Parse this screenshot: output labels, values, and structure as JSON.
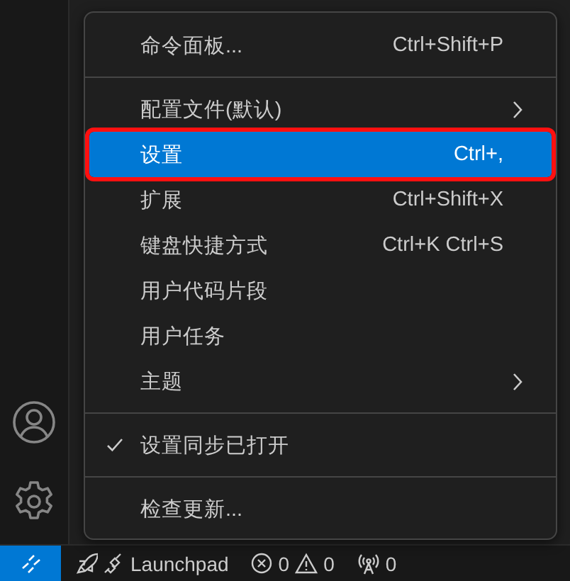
{
  "activity_bar": {
    "items": [
      {
        "kind": "account"
      },
      {
        "kind": "settings"
      }
    ]
  },
  "menu": {
    "items": [
      {
        "kind": "command",
        "label": "命令面板...",
        "shortcut": "Ctrl+Shift+P",
        "selected": false,
        "checked": false,
        "outlined": false
      },
      {
        "kind": "separator"
      },
      {
        "kind": "submenu",
        "label": "配置文件(默认)",
        "selected": false,
        "checked": false,
        "outlined": false
      },
      {
        "kind": "command",
        "label": "设置",
        "shortcut": "Ctrl+,",
        "selected": true,
        "checked": false,
        "outlined": true
      },
      {
        "kind": "command",
        "label": "扩展",
        "shortcut": "Ctrl+Shift+X",
        "selected": false,
        "checked": false,
        "outlined": false
      },
      {
        "kind": "command",
        "label": "键盘快捷方式",
        "shortcut": "Ctrl+K Ctrl+S",
        "selected": false,
        "checked": false,
        "outlined": false
      },
      {
        "kind": "command",
        "label": "用户代码片段",
        "selected": false,
        "checked": false,
        "outlined": false
      },
      {
        "kind": "command",
        "label": "用户任务",
        "selected": false,
        "checked": false,
        "outlined": false
      },
      {
        "kind": "submenu",
        "label": "主题",
        "selected": false,
        "checked": false,
        "outlined": false
      },
      {
        "kind": "separator"
      },
      {
        "kind": "command",
        "label": "设置同步已打开",
        "selected": false,
        "checked": true,
        "outlined": false
      },
      {
        "kind": "separator"
      },
      {
        "kind": "command",
        "label": "检查更新...",
        "selected": false,
        "checked": false,
        "outlined": false
      }
    ]
  },
  "status_bar": {
    "items": [
      {
        "kind": "remote"
      },
      {
        "kind": "launchpad",
        "label": "Launchpad"
      },
      {
        "kind": "problems",
        "errors": "0",
        "warnings": "0"
      },
      {
        "kind": "ports",
        "label": "0"
      }
    ]
  }
}
